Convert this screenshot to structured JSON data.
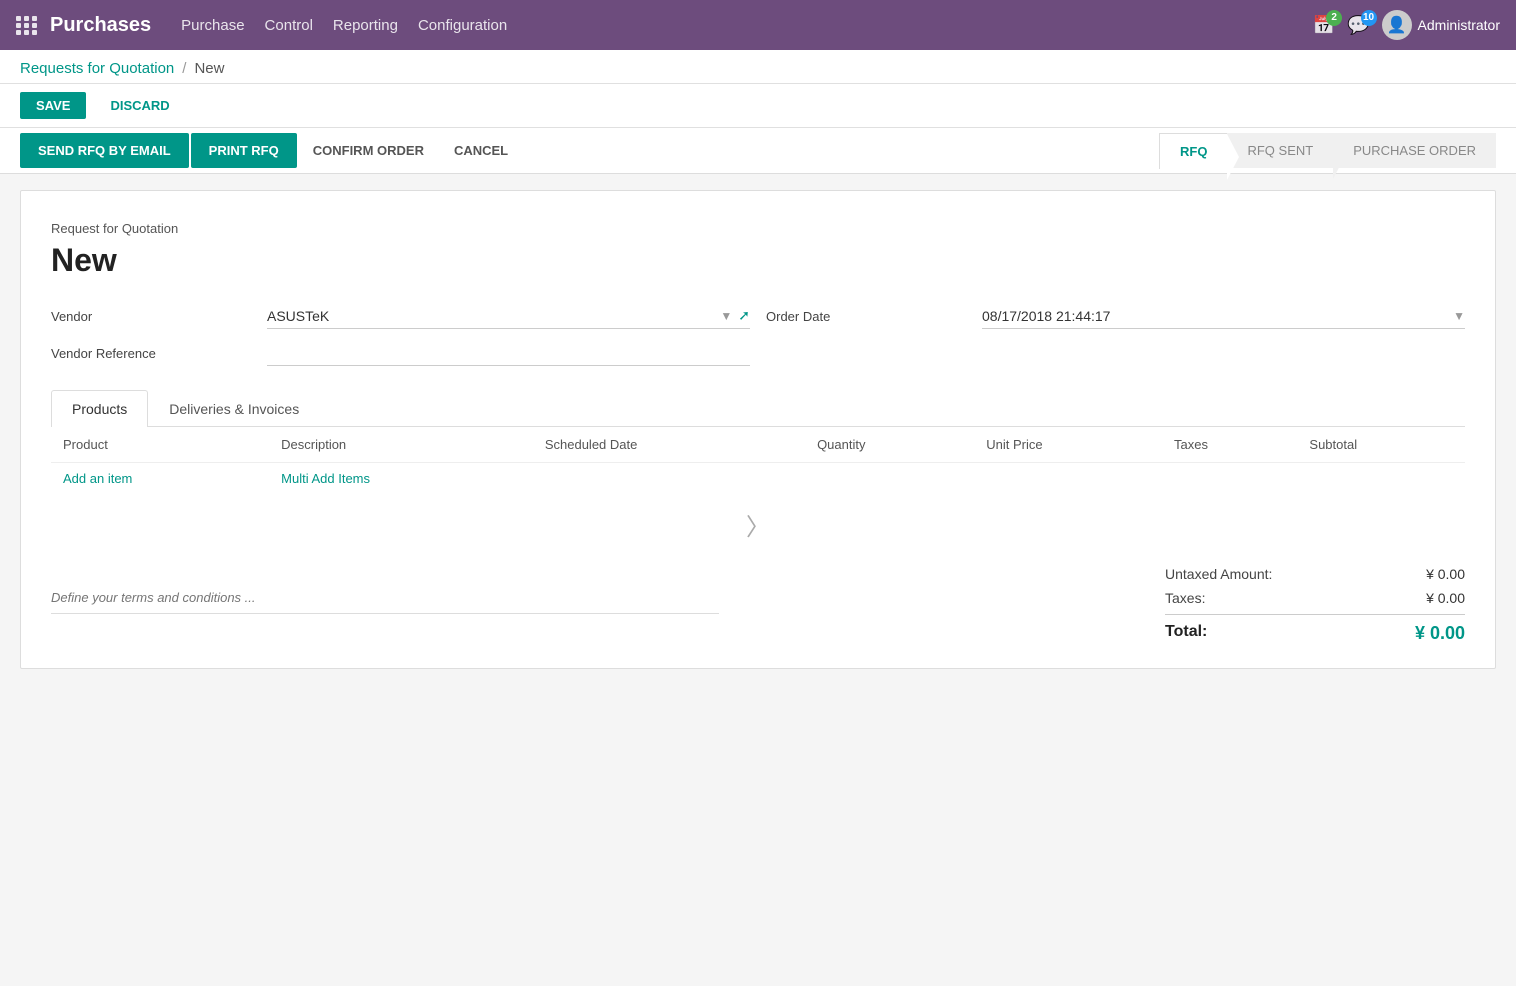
{
  "topnav": {
    "app_title": "Purchases",
    "nav_items": [
      {
        "label": "Purchase",
        "id": "purchase"
      },
      {
        "label": "Control",
        "id": "control"
      },
      {
        "label": "Reporting",
        "id": "reporting"
      },
      {
        "label": "Configuration",
        "id": "configuration"
      }
    ],
    "notification_badge1": "2",
    "notification_badge2": "10",
    "admin_label": "Administrator"
  },
  "breadcrumb": {
    "parent": "Requests for Quotation",
    "separator": "/",
    "current": "New"
  },
  "action_buttons": {
    "save": "SAVE",
    "discard": "DISCARD"
  },
  "workflow": {
    "send_rfq": "SEND RFQ BY EMAIL",
    "print_rfq": "PRINT RFQ",
    "confirm_order": "CONFIRM ORDER",
    "cancel": "CANCEL",
    "steps": [
      {
        "label": "RFQ",
        "active": true
      },
      {
        "label": "RFQ SENT",
        "active": false
      },
      {
        "label": "PURCHASE ORDER",
        "active": false
      }
    ]
  },
  "form": {
    "subtitle": "Request for Quotation",
    "title": "New",
    "vendor_label": "Vendor",
    "vendor_value": "ASUSTeK",
    "vendor_ref_label": "Vendor Reference",
    "vendor_ref_value": "",
    "order_date_label": "Order Date",
    "order_date_value": "08/17/2018 21:44:17"
  },
  "tabs": [
    {
      "label": "Products",
      "active": true
    },
    {
      "label": "Deliveries & Invoices",
      "active": false
    }
  ],
  "table": {
    "columns": [
      "Product",
      "Description",
      "Scheduled Date",
      "Quantity",
      "Unit Price",
      "Taxes",
      "Subtotal"
    ],
    "add_item_label": "Add an item",
    "multi_add_label": "Multi Add Items",
    "rows": []
  },
  "terms": {
    "placeholder": "Define your terms and conditions ..."
  },
  "totals": {
    "untaxed_label": "Untaxed Amount:",
    "untaxed_value": "¥ 0.00",
    "taxes_label": "Taxes:",
    "taxes_value": "¥ 0.00",
    "total_label": "Total:",
    "total_value": "¥ 0.00"
  }
}
